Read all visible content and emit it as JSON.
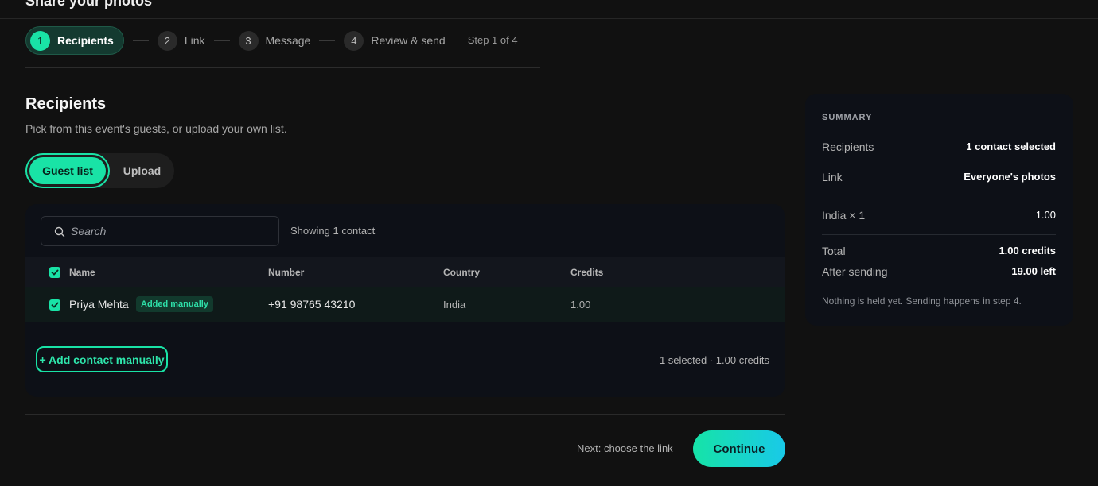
{
  "header": {
    "title": "Share your photos"
  },
  "stepper": {
    "steps": [
      {
        "num": "1",
        "label": "Recipients"
      },
      {
        "num": "2",
        "label": "Link"
      },
      {
        "num": "3",
        "label": "Message"
      },
      {
        "num": "4",
        "label": "Review & send"
      }
    ],
    "progress": "Step 1 of 4"
  },
  "section": {
    "title": "Recipients",
    "subtitle": "Pick from this event's guests, or upload your own list."
  },
  "source_toggle": {
    "guest_list": "Guest list",
    "upload": "Upload"
  },
  "table_panel": {
    "search_placeholder": "Search",
    "showing": "Showing 1 contact",
    "columns": {
      "name": "Name",
      "number": "Number",
      "country": "Country",
      "credits": "Credits"
    },
    "rows": [
      {
        "name": "Priya Mehta",
        "badge": "Added manually",
        "number": "+91 98765 43210",
        "country": "India",
        "credits": "1.00",
        "checked": true
      }
    ],
    "add_contact": "+ Add contact manually",
    "selected_summary": "1 selected · 1.00 credits"
  },
  "footer": {
    "next_hint": "Next: choose the link",
    "continue": "Continue"
  },
  "summary": {
    "title": "SUMMARY",
    "recipients_label": "Recipients",
    "recipients_value": "1 contact selected",
    "link_label": "Link",
    "link_value": "Everyone's photos",
    "line_label": "India × 1",
    "line_value": "1.00",
    "total_label": "Total",
    "total_value": "1.00 credits",
    "after_label": "After sending",
    "after_value": "19.00 left",
    "note": "Nothing is held yet. Sending happens in step 4."
  },
  "colors": {
    "accent": "#19e3a6",
    "background": "#111111",
    "panel": "#0d1017"
  }
}
